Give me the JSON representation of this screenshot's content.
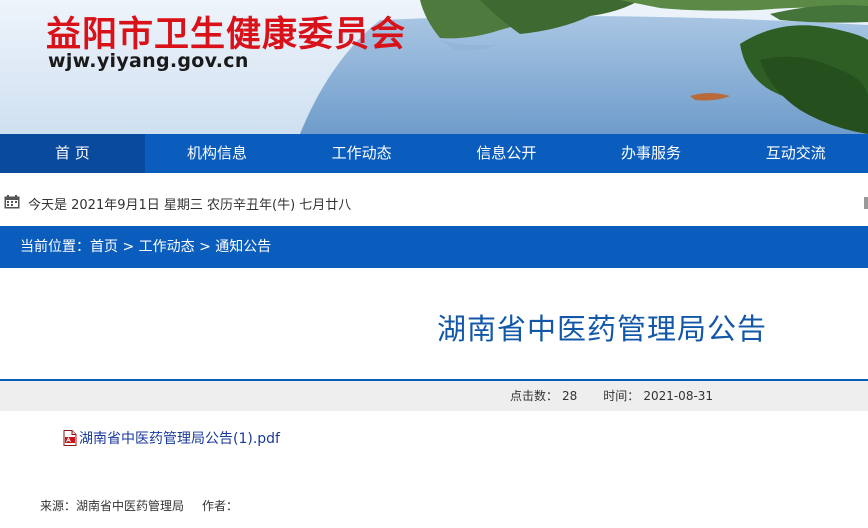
{
  "header": {
    "site_title": "益阳市卫生健康委员会",
    "site_url": "wjw.yiyang.gov.cn"
  },
  "nav": {
    "items": [
      {
        "label": "首 页",
        "active": true
      },
      {
        "label": "机构信息"
      },
      {
        "label": "工作动态"
      },
      {
        "label": "信息公开"
      },
      {
        "label": "办事服务"
      },
      {
        "label": "互动交流"
      }
    ]
  },
  "datebar": {
    "text": "今天是 2021年9月1日 星期三 农历辛丑年(牛) 七月廿八",
    "icon": "calendar-icon"
  },
  "breadcrumb": {
    "prefix": "当前位置：",
    "items": [
      "首页",
      "工作动态",
      "通知公告"
    ],
    "separator": " > "
  },
  "article": {
    "title": "湖南省中医药管理局公告",
    "clicks_label": "点击数：",
    "clicks_value": "28",
    "time_label": "时间：",
    "time_value": "2021-08-31",
    "attachment": "湖南省中医药管理局公告(1).pdf",
    "attachment_icon": "pdf-file-icon",
    "source_label": "来源：",
    "source_value": "湖南省中医药管理局",
    "author_label": "作者："
  },
  "colors": {
    "brand_blue": "#0b5dbd",
    "title_red": "#d9121a",
    "article_title_blue": "#1358a8"
  }
}
